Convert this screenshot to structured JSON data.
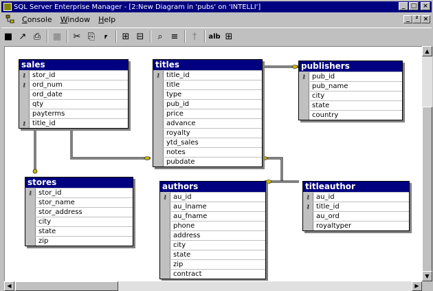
{
  "window": {
    "title": "SQL Server Enterprise Manager - [2:New Diagram in 'pubs' on 'INTELLI']",
    "buttons": [
      "_",
      "□",
      "×"
    ]
  },
  "menubar": {
    "items": [
      {
        "label": "Console",
        "underline": "C"
      },
      {
        "label": "Window",
        "underline": "W"
      },
      {
        "label": "Help",
        "underline": "H"
      }
    ],
    "mdi_buttons": [
      "_",
      "²",
      "×"
    ]
  },
  "toolbar": {
    "buttons": [
      {
        "name": "save-icon",
        "glyph": "■"
      },
      {
        "name": "open-icon",
        "glyph": "↗"
      },
      {
        "name": "print-icon",
        "glyph": "⎙"
      },
      {
        "name": "table-icon",
        "glyph": "▦"
      },
      {
        "name": "cut-icon",
        "glyph": "✂"
      },
      {
        "name": "copy-icon",
        "glyph": "⎘"
      },
      {
        "name": "paste-icon",
        "glyph": "⎖"
      },
      {
        "name": "new-table-icon",
        "glyph": "⊞"
      },
      {
        "name": "add-table-icon",
        "glyph": "⊟"
      },
      {
        "name": "zoom-icon",
        "glyph": "⌕"
      },
      {
        "name": "properties-icon",
        "glyph": "≡"
      },
      {
        "name": "key-icon",
        "glyph": "†"
      },
      {
        "name": "text-label-icon",
        "glyph": "alb"
      },
      {
        "name": "arrange-tables-icon",
        "glyph": "⊞"
      }
    ]
  },
  "tables": {
    "sales": {
      "name": "sales",
      "columns": [
        {
          "name": "stor_id",
          "key": true
        },
        {
          "name": "ord_num",
          "key": true
        },
        {
          "name": "ord_date",
          "key": false
        },
        {
          "name": "qty",
          "key": false
        },
        {
          "name": "payterms",
          "key": false
        },
        {
          "name": "title_id",
          "key": true
        }
      ]
    },
    "titles": {
      "name": "titles",
      "columns": [
        {
          "name": "title_id",
          "key": true
        },
        {
          "name": "title",
          "key": false
        },
        {
          "name": "type",
          "key": false
        },
        {
          "name": "pub_id",
          "key": false
        },
        {
          "name": "price",
          "key": false
        },
        {
          "name": "advance",
          "key": false
        },
        {
          "name": "royalty",
          "key": false
        },
        {
          "name": "ytd_sales",
          "key": false
        },
        {
          "name": "notes",
          "key": false
        },
        {
          "name": "pubdate",
          "key": false
        }
      ]
    },
    "publishers": {
      "name": "publishers",
      "columns": [
        {
          "name": "pub_id",
          "key": true
        },
        {
          "name": "pub_name",
          "key": false
        },
        {
          "name": "city",
          "key": false
        },
        {
          "name": "state",
          "key": false
        },
        {
          "name": "country",
          "key": false
        }
      ]
    },
    "stores": {
      "name": "stores",
      "columns": [
        {
          "name": "stor_id",
          "key": true
        },
        {
          "name": "stor_name",
          "key": false
        },
        {
          "name": "stor_address",
          "key": false
        },
        {
          "name": "city",
          "key": false
        },
        {
          "name": "state",
          "key": false
        },
        {
          "name": "zip",
          "key": false
        }
      ]
    },
    "authors": {
      "name": "authors",
      "columns": [
        {
          "name": "au_id",
          "key": true
        },
        {
          "name": "au_lname",
          "key": false
        },
        {
          "name": "au_fname",
          "key": false
        },
        {
          "name": "phone",
          "key": false
        },
        {
          "name": "address",
          "key": false
        },
        {
          "name": "city",
          "key": false
        },
        {
          "name": "state",
          "key": false
        },
        {
          "name": "zip",
          "key": false
        },
        {
          "name": "contract",
          "key": false
        }
      ]
    },
    "titleauthor": {
      "name": "titleauthor",
      "columns": [
        {
          "name": "au_id",
          "key": true
        },
        {
          "name": "title_id",
          "key": true
        },
        {
          "name": "au_ord",
          "key": false
        },
        {
          "name": "royaltyper",
          "key": false
        }
      ]
    }
  },
  "colors": {
    "title_bar": "#000080",
    "table_header": "#000080",
    "relationship_key_end": "#c8b400"
  }
}
